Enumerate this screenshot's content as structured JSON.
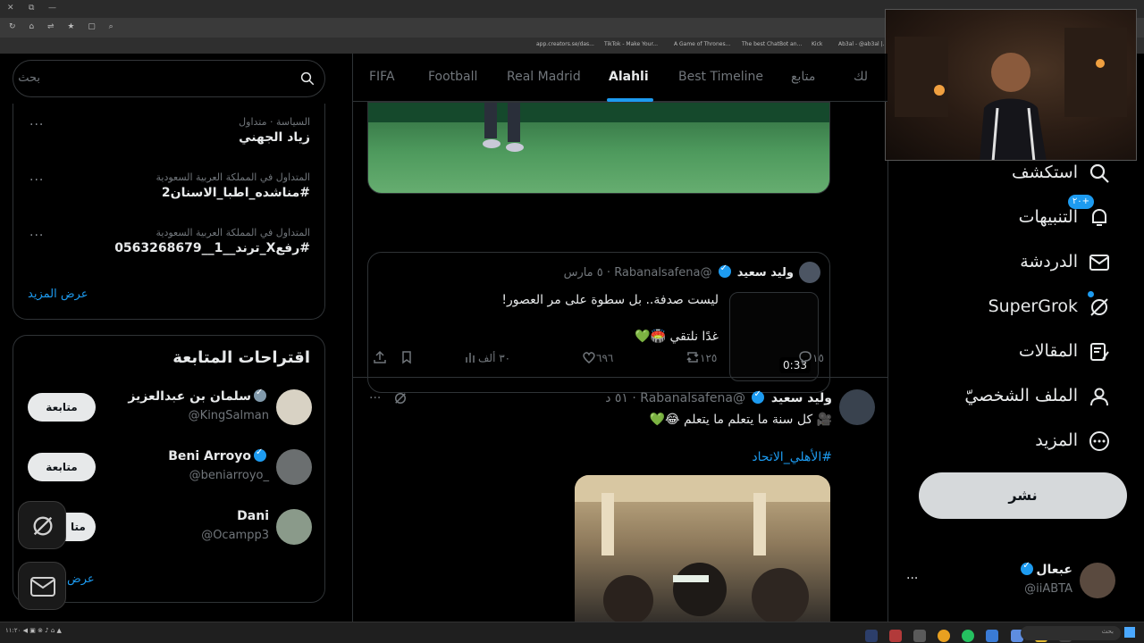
{
  "browser": {
    "window_buttons": [
      "✕",
      "⧉",
      "—"
    ],
    "bookmarks": [
      "app.creators.se/das...",
      "TikTok - Make Your...",
      "A Game of Thrones...",
      "The best ChatBot an...",
      "Kick",
      "Ab3al - @ab3al |..."
    ]
  },
  "search": {
    "placeholder": "بحث"
  },
  "trends": {
    "items": [
      {
        "context": "السياسة · متداول",
        "title": "زياد الجهني"
      },
      {
        "context": "المتداول في المملكة العربية السعودية",
        "title": "#مناشده_اطبا_الاسنان2"
      },
      {
        "context": "المتداول في المملكة العربية السعودية",
        "title": "#رفعX_ترند__1__0563268679"
      }
    ],
    "show_more": "عرض المزيد"
  },
  "who_to_follow": {
    "heading": "اقتراحات المتابعة",
    "follow_label": "متابعة",
    "users": [
      {
        "name": "سلمان بن عبدالعزيز",
        "handle": "@KingSalman",
        "badge": "gray"
      },
      {
        "name": "Beni Arroyo",
        "handle": "@beniarroyo_",
        "badge": "blue"
      },
      {
        "name": "Dani",
        "handle": "@Ocampp3",
        "badge": ""
      }
    ],
    "follow_partial": "متا",
    "show_more_partial": "عرض"
  },
  "tabs": [
    "FIFA",
    "Football",
    "Real Madrid",
    "Alahli",
    "Best Timeline",
    "متابع",
    "لك"
  ],
  "active_tab": "Alahli",
  "quoted_post": {
    "name": "وليد سعيد",
    "handle": "@Rabanalsafena",
    "time": "· ٥ مارس",
    "line1": "ليست صدفة.. بل سطوة على مر العصور!",
    "line2": "غدًا نلتقي 🏟️💚",
    "video_duration": "0:33"
  },
  "actions": {
    "replies": "١٥",
    "reposts": "١٢٥",
    "likes": "٦٩٦",
    "views": "٣٠ ألف"
  },
  "post2": {
    "name": "وليد سعيد",
    "handle": "@Rabanalsafena",
    "time": "· ٥١ د",
    "text": "🎥 كل سنة ما يتعلم ما يتعلم 😂💚",
    "hashtag": "#الأهلي_الاتحاد",
    "more": "···"
  },
  "nav": {
    "items": [
      {
        "label": "استكشف",
        "icon": "search-icon"
      },
      {
        "label": "التنبيهات",
        "icon": "bell-icon",
        "badge": "٢٠+"
      },
      {
        "label": "الدردشة",
        "icon": "mail-icon"
      },
      {
        "label": "SuperGrok",
        "icon": "grok-icon"
      },
      {
        "label": "المقالات",
        "icon": "articles-icon"
      },
      {
        "label": "الملف الشخصيّ",
        "icon": "profile-icon"
      },
      {
        "label": "المزيد",
        "icon": "more-circle-icon"
      }
    ],
    "post_button": "نشر"
  },
  "account": {
    "name": "عبعال",
    "handle": "@iiABTA",
    "more": "···"
  },
  "taskbar": {
    "search_placeholder": "بحث",
    "clock": "١١:٢٠"
  },
  "colors": {
    "accent": "#1d9bf0",
    "background": "#000000",
    "border": "#2f3336",
    "muted": "#71767b"
  }
}
